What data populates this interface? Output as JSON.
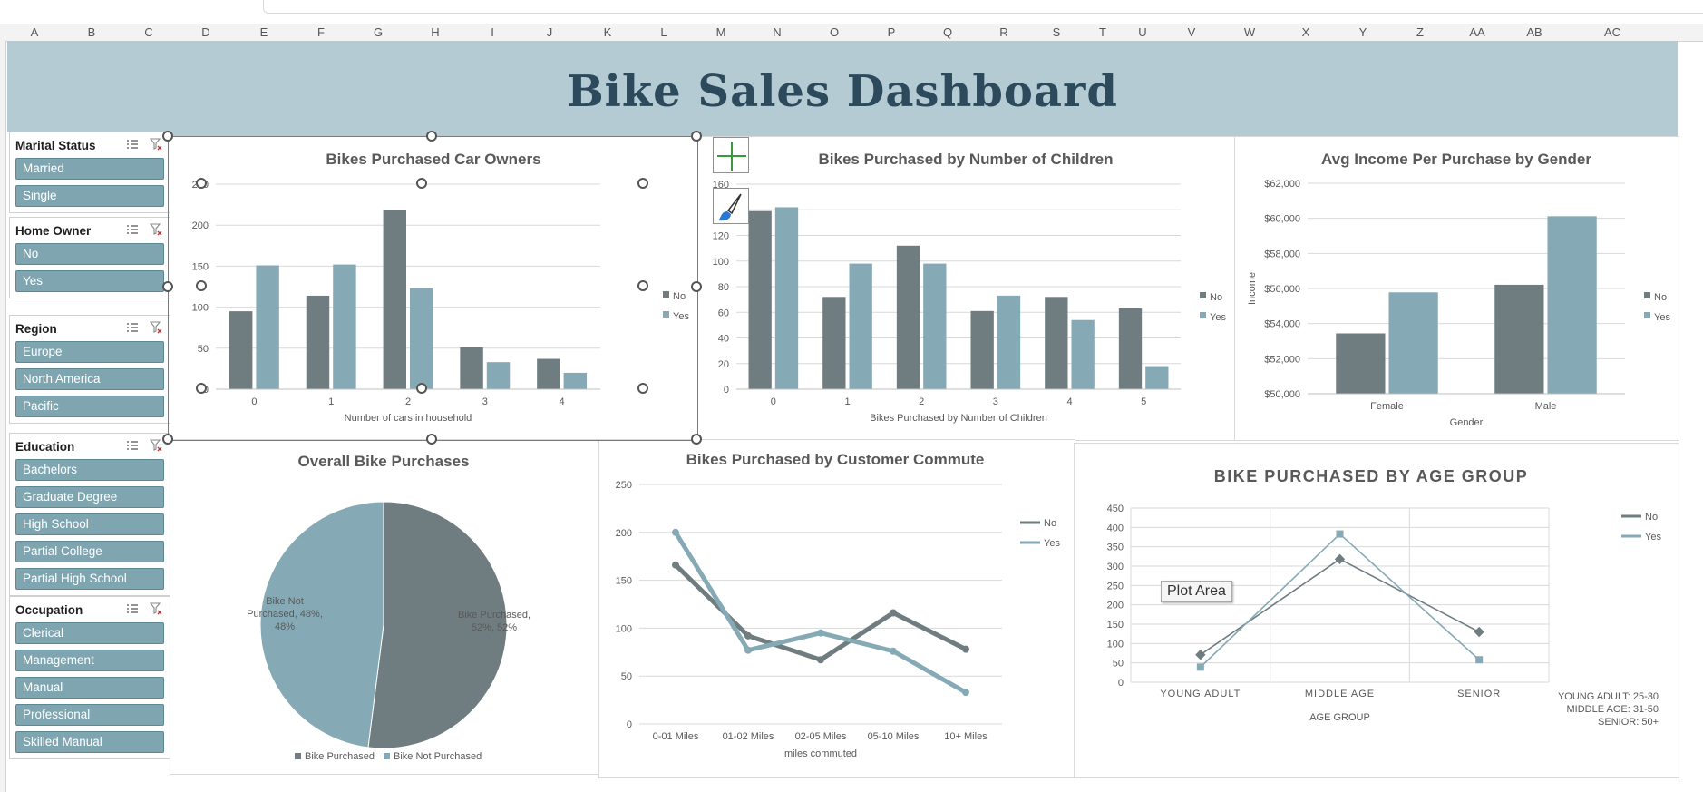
{
  "columns": [
    "A",
    "B",
    "C",
    "D",
    "E",
    "F",
    "G",
    "H",
    "I",
    "J",
    "K",
    "L",
    "M",
    "N",
    "O",
    "P",
    "Q",
    "R",
    "S",
    "T",
    "U",
    "V",
    "W",
    "X",
    "Y",
    "Z",
    "AA",
    "AB",
    "AC"
  ],
  "dashboard": {
    "title": "Bike Sales Dashboard"
  },
  "slicers": [
    {
      "title": "Marital Status",
      "items": [
        "Married",
        "Single"
      ]
    },
    {
      "title": "Home Owner",
      "items": [
        "No",
        "Yes"
      ]
    },
    {
      "title": "Region",
      "items": [
        "Europe",
        "North America",
        "Pacific"
      ]
    },
    {
      "title": "Education",
      "items": [
        "Bachelors",
        "Graduate Degree",
        "High School",
        "Partial College",
        "Partial High School"
      ]
    },
    {
      "title": "Occupation",
      "items": [
        "Clerical",
        "Management",
        "Manual",
        "Professional",
        "Skilled Manual"
      ]
    }
  ],
  "colors": {
    "no": "#6f7d80",
    "yes": "#86aab5",
    "banner": "#b5cbd3",
    "slicer_item": "#7fa5b0"
  },
  "tooltip": {
    "text": "Plot Area"
  },
  "chart_data": [
    {
      "id": "car",
      "type": "bar",
      "title": "Bikes Purchased Car Owners",
      "xlabel": "Number of cars in household",
      "ylabel": "",
      "categories": [
        "0",
        "1",
        "2",
        "3",
        "4"
      ],
      "ylim": [
        0,
        250
      ],
      "yticks": [
        0,
        50,
        100,
        150,
        200,
        250
      ],
      "series": [
        {
          "name": "No",
          "values": [
            95,
            114,
            218,
            51,
            37
          ]
        },
        {
          "name": "Yes",
          "values": [
            151,
            152,
            123,
            33,
            20
          ]
        }
      ],
      "legend": "right"
    },
    {
      "id": "children",
      "type": "bar",
      "title": "Bikes Purchased by Number of Children",
      "xlabel": "Bikes Purchased by Number of Children",
      "ylabel": "",
      "categories": [
        "0",
        "1",
        "2",
        "3",
        "4",
        "5"
      ],
      "ylim": [
        0,
        160
      ],
      "yticks": [
        0,
        20,
        40,
        60,
        80,
        100,
        120,
        140,
        160
      ],
      "series": [
        {
          "name": "No",
          "values": [
            139,
            72,
            112,
            61,
            72,
            63
          ]
        },
        {
          "name": "Yes",
          "values": [
            142,
            98,
            98,
            73,
            54,
            18
          ]
        }
      ],
      "legend": "right"
    },
    {
      "id": "income",
      "type": "bar",
      "title": "Avg Income Per Purchase by Gender",
      "xlabel": "Gender",
      "ylabel": "Income",
      "categories": [
        "Female",
        "Male"
      ],
      "ylim": [
        50000,
        62000
      ],
      "yticks": [
        50000,
        52000,
        54000,
        56000,
        58000,
        60000,
        62000
      ],
      "ytick_labels": [
        "$50,000",
        "$52,000",
        "$54,000",
        "$56,000",
        "$58,000",
        "$60,000",
        "$62,000"
      ],
      "series": [
        {
          "name": "No",
          "values": [
            53440,
            56210
          ]
        },
        {
          "name": "Yes",
          "values": [
            55780,
            60120
          ]
        }
      ],
      "legend": "right"
    },
    {
      "id": "overall",
      "type": "pie",
      "title": "Overall Bike Purchases",
      "slices": [
        {
          "name": "Bike Purchased",
          "value": 52,
          "label": [
            "Bike Purchased,",
            "52%, 52%"
          ]
        },
        {
          "name": "Bike Not Purchased",
          "value": 48,
          "label": [
            "Bike Not",
            "Purchased, 48%,",
            "48%"
          ]
        }
      ],
      "legend": "bottom"
    },
    {
      "id": "commute",
      "type": "line",
      "title": "Bikes Purchased by Customer Commute",
      "xlabel": "miles commuted",
      "ylabel": "",
      "categories": [
        "0-01 Miles",
        "01-02 Miles",
        "02-05 Miles",
        "05-10 Miles",
        "10+ Miles"
      ],
      "ylim": [
        0,
        250
      ],
      "yticks": [
        0,
        50,
        100,
        150,
        200,
        250
      ],
      "series": [
        {
          "name": "No",
          "values": [
            166,
            92,
            67,
            116,
            78
          ]
        },
        {
          "name": "Yes",
          "values": [
            200,
            77,
            95,
            76,
            33
          ]
        }
      ],
      "legend": "right"
    },
    {
      "id": "age",
      "type": "line",
      "title": "BIKE PURCHASED BY AGE GROUP",
      "xlabel": "AGE GROUP",
      "ylabel": "",
      "categories": [
        "YOUNG ADULT",
        "MIDDLE AGE",
        "SENIOR"
      ],
      "ylim": [
        0,
        450
      ],
      "yticks": [
        0,
        50,
        100,
        150,
        200,
        250,
        300,
        350,
        400,
        450
      ],
      "series": [
        {
          "name": "No",
          "values": [
            71,
            318,
            130
          ]
        },
        {
          "name": "Yes",
          "values": [
            39,
            383,
            58
          ]
        }
      ],
      "legend": "right",
      "note": [
        "YOUNG ADULT: 25-30",
        "MIDDLE AGE: 31-50",
        "SENIOR: 50+"
      ]
    }
  ]
}
